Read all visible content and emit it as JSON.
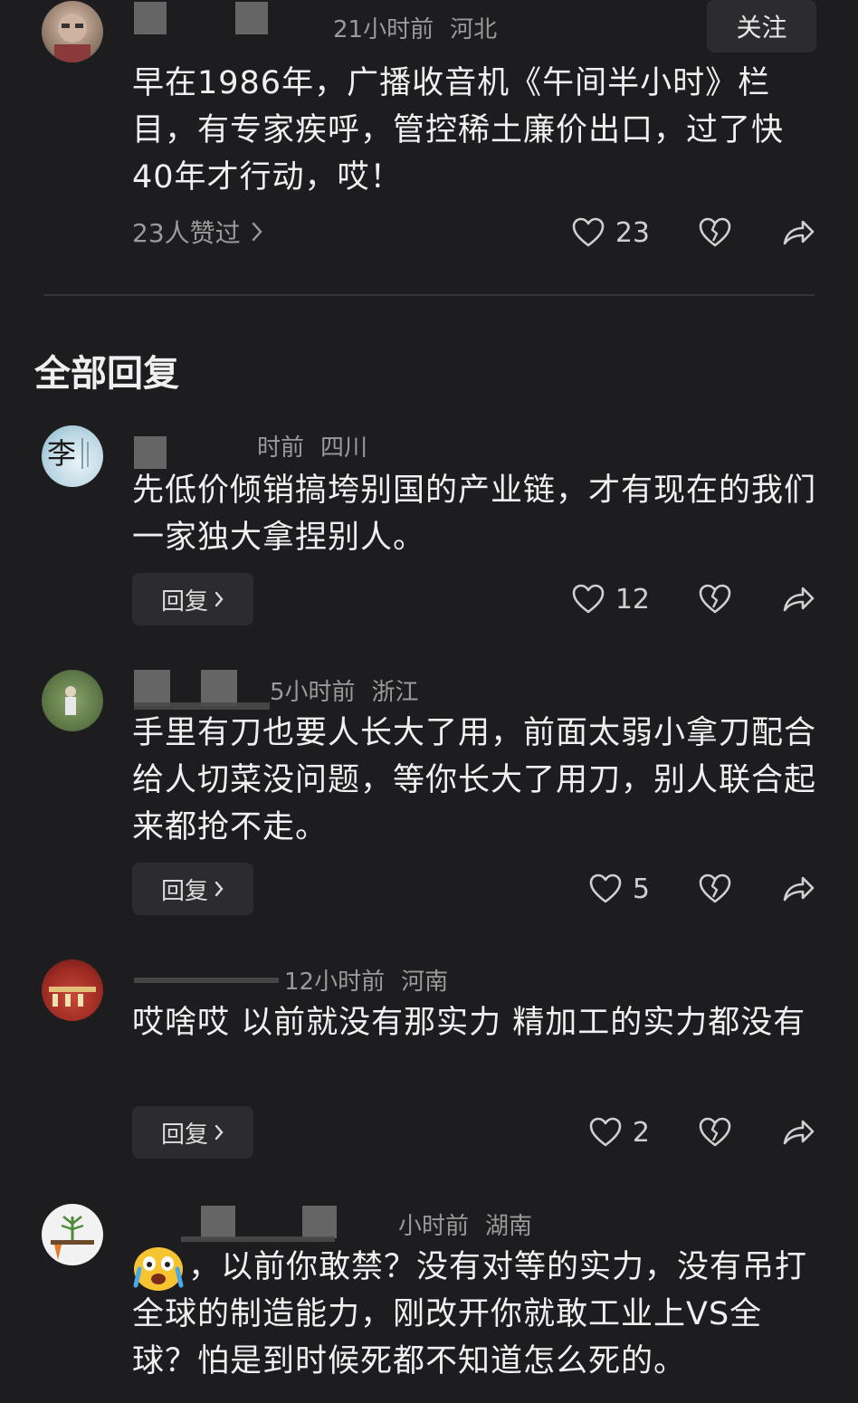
{
  "top_comment": {
    "time": "21小时前",
    "location": "河北",
    "follow_label": "关注",
    "text": "早在1986年，广播收音机《午间半小时》栏目，有专家疾呼，管控稀土廉价出口，过了快40年才行动，哎！",
    "likers": "23人赞过",
    "like_count": "23"
  },
  "section_title": "全部回复",
  "replies": [
    {
      "time": "时前",
      "location": "四川",
      "avatar_char": "李",
      "text": "先低价倾销搞垮别国的产业链，才有现在的我们一家独大拿捏别人。",
      "reply_label": "回复",
      "like_count": "12"
    },
    {
      "time": "5小时前",
      "location": "浙江",
      "text": "手里有刀也要人长大了用，前面太弱小拿刀配合给人切菜没问题，等你长大了用刀，别人联合起来都抢不走。",
      "reply_label": "回复",
      "like_count": "5"
    },
    {
      "time": "12小时前",
      "location": "河南",
      "text": "哎啥哎 以前就没有那实力 精加工的实力都没有",
      "reply_label": "回复",
      "like_count": "2"
    },
    {
      "time": "小时前",
      "location": "湖南",
      "text": "，以前你敢禁？没有对等的实力，没有吊打全球的制造能力，刚改开你就敢工业上VS全球？怕是到时候死都不知道怎么死的。"
    }
  ],
  "colors": {
    "background": "#1d1d1f",
    "text": "#f0f0f0",
    "muted": "#9a9a9a",
    "button_bg": "#2c2c2e"
  }
}
